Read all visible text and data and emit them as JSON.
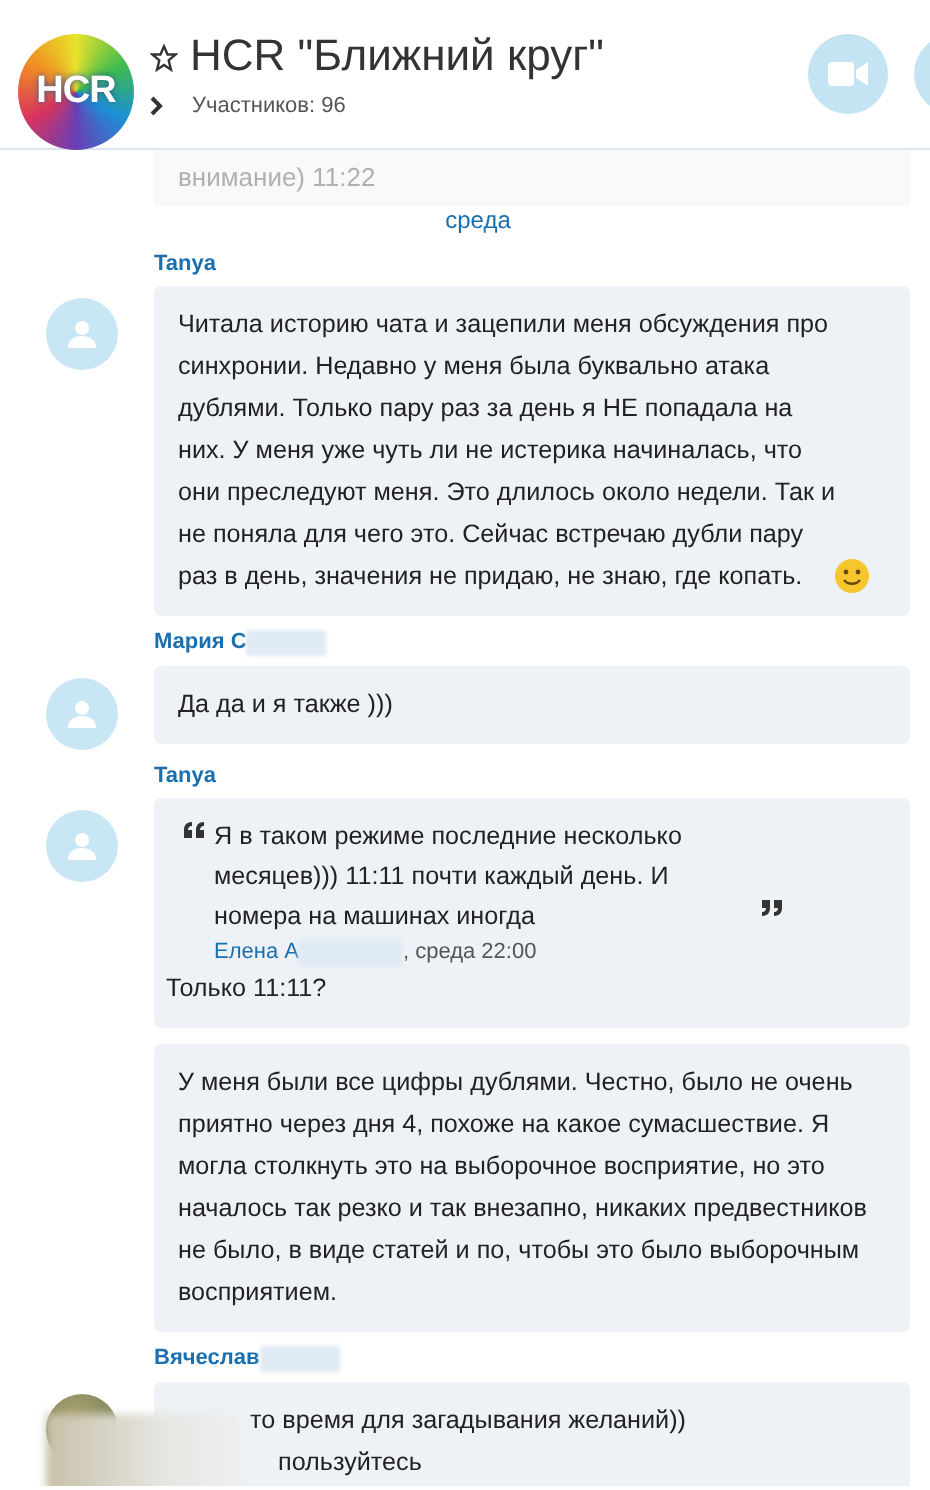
{
  "header": {
    "logo": "HCR",
    "title": "HCR \"Ближний круг\"",
    "favorite": false,
    "subtitle": "Участников: 96"
  },
  "faded_message": "внимание) 11:22",
  "day_label": "среда",
  "messages": [
    {
      "sender": "Tanya",
      "avatar_photo": false,
      "bubbles": [
        {
          "kind": "text",
          "text": "Читала историю чата и зацепили меня обсуждения про синхронии. Недавно у меня была буквально атака дублями. Только пару раз за день я НЕ попадала на них. У меня уже чуть ли не истерика начиналась, что они преследуют меня. Это длилось около недели. Так и не поняла для чего это. Сейчас встречаю дубли пару раз в день, значения не придаю, не знаю, где копать.",
          "emoji": true
        }
      ]
    },
    {
      "sender": "Мария С",
      "redacted": true,
      "avatar_photo": false,
      "bubbles": [
        {
          "kind": "text",
          "text": "Да да и я также )))"
        }
      ]
    },
    {
      "sender": "Tanya",
      "avatar_photo": false,
      "bubbles": [
        {
          "kind": "quote",
          "quote": "Я в таком режиме последние несколько месяцев))) 11:11 почти каждый день. И номера на машинах иногда",
          "quote_author": "Елена А",
          "author_redacted": true,
          "quote_time": ", среда 22:00",
          "reply": "Только 11:11?"
        },
        {
          "kind": "text",
          "text": "У меня были все цифры дублями. Честно, было не очень приятно через дня 4, похоже на какое сумасшествие. Я могла столкнуть это на выборочное восприятие, но это началось так резко и так внезапно, никаких предвестников не было, в виде статей и по, чтобы это было выборочным восприятием."
        }
      ]
    },
    {
      "sender": "Вячеслав",
      "redacted": true,
      "avatar_photo": true,
      "bubbles": [
        {
          "kind": "partial",
          "lines": [
            "то время для загадывания желаний))",
            "пользуйтесь"
          ]
        }
      ]
    }
  ]
}
